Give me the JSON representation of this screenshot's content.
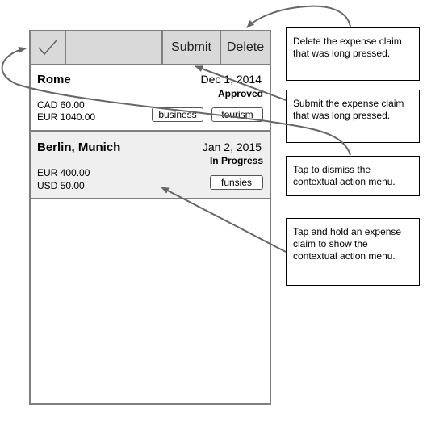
{
  "action_bar": {
    "check_icon": "checkmark-icon",
    "submit_label": "Submit",
    "delete_label": "Delete"
  },
  "claims": [
    {
      "destination": "Rome",
      "date": "Dec 1, 2014",
      "status": "Approved",
      "amounts": [
        "CAD 60.00",
        "EUR 1040.00"
      ],
      "tags": [
        "business",
        "tourism"
      ]
    },
    {
      "destination": "Berlin, Munich",
      "date": "Jan 2, 2015",
      "status": "In Progress",
      "amounts": [
        "EUR 400.00",
        "USD 50.00"
      ],
      "tags": [
        "funsies"
      ]
    }
  ],
  "annotations": {
    "delete": "Delete the expense claim that was long pressed.",
    "submit": "Submit the expense claim that was long pressed.",
    "dismiss": "Tap to dismiss the contextual action menu.",
    "hold": "Tap and hold an expense claim to show the contextual action menu."
  },
  "colors": {
    "frame": "#7f7f7f",
    "action_bar_bg": "#d9d9d9",
    "selected_row_bg": "#efefef",
    "arrow": "#666666"
  }
}
